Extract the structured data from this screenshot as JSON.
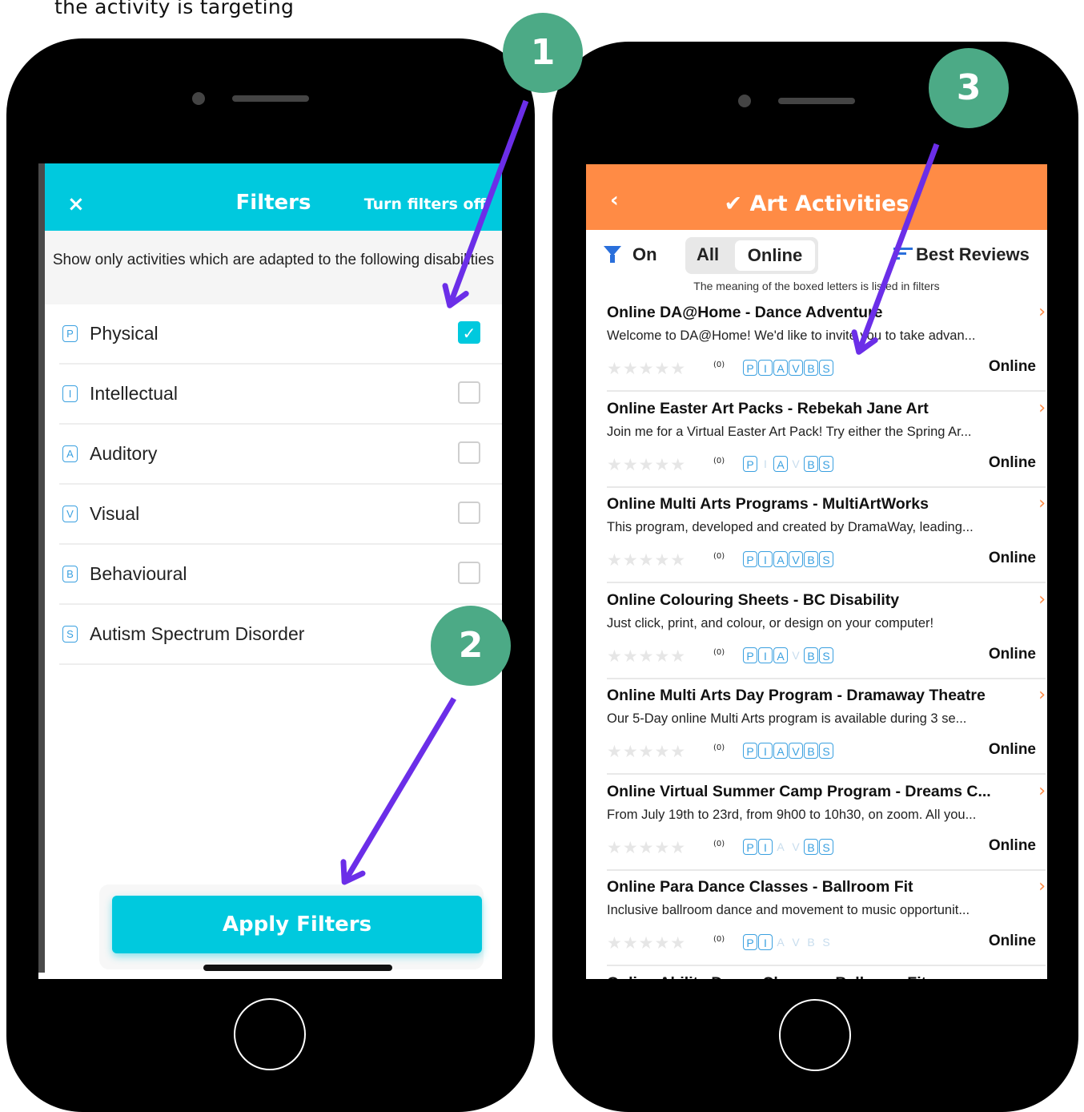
{
  "caption": "the activity is targeting",
  "badges": [
    "1",
    "2",
    "3"
  ],
  "filters": {
    "close_icon": "×",
    "title": "Filters",
    "turn_off": "Turn filters off",
    "intro": "Show only activities which are adapted to the following disabilities",
    "options": [
      {
        "letter": "P",
        "label": "Physical",
        "checked": true
      },
      {
        "letter": "I",
        "label": "Intellectual",
        "checked": false
      },
      {
        "letter": "A",
        "label": "Auditory",
        "checked": false
      },
      {
        "letter": "V",
        "label": "Visual",
        "checked": false
      },
      {
        "letter": "B",
        "label": "Behavioural",
        "checked": false
      },
      {
        "letter": "S",
        "label": "Autism Spectrum Disorder",
        "checked": false
      }
    ],
    "apply_label": "Apply Filters"
  },
  "activities": {
    "back_icon": "‹",
    "title": "Art Activities",
    "filter_state": "On",
    "seg_all": "All",
    "seg_online": "Online",
    "sort_label": "Best Reviews",
    "note": "The meaning of the boxed letters is listed in filters",
    "items": [
      {
        "name": "Online DA@Home - Dance Adventure",
        "desc": "Welcome to DA@Home! We'd like to invite you to take advan...",
        "count": "(0)",
        "letters": "PIAVBS",
        "active": "PIAVBS",
        "mode": "Online"
      },
      {
        "name": "Online Easter Art Packs - Rebekah Jane Art",
        "desc": "Join me for a Virtual Easter Art Pack! Try either the Spring Ar...",
        "count": "(0)",
        "letters": "PIAVBS",
        "active": "PABS",
        "mode": "Online"
      },
      {
        "name": "Online Multi Arts Programs - MultiArtWorks",
        "desc": "This program, developed and created by DramaWay, leading...",
        "count": "(0)",
        "letters": "PIAVBS",
        "active": "PIAVBS",
        "mode": "Online"
      },
      {
        "name": "Online Colouring Sheets - BC Disability",
        "desc": "Just click, print, and colour, or design on your computer!",
        "count": "(0)",
        "letters": "PIAVBS",
        "active": "PIABS",
        "mode": "Online"
      },
      {
        "name": "Online Multi Arts Day Program - Dramaway Theatre",
        "desc": "Our 5-Day online Multi Arts program is available during 3 se...",
        "count": "(0)",
        "letters": "PIAVBS",
        "active": "PIAVBS",
        "mode": "Online"
      },
      {
        "name": "Online Virtual Summer Camp Program - Dreams C...",
        "desc": "From July 19th to 23rd, from 9h00 to 10h30, on zoom. All you...",
        "count": "(0)",
        "letters": "PIAVBS",
        "active": "PIBS",
        "mode": "Online"
      },
      {
        "name": "Online Para Dance Classes - Ballroom Fit",
        "desc": "Inclusive ballroom dance and movement to music opportunit...",
        "count": "(0)",
        "letters": "PIAVBS",
        "active": "PI",
        "mode": "Online"
      },
      {
        "name": "Online Ability Dance Classes - Ballroom Fit",
        "desc": "",
        "count": "",
        "letters": "",
        "active": "",
        "mode": ""
      }
    ]
  },
  "colors": {
    "filters_header": "#00c9de",
    "activities_header": "#ff8b45",
    "badge": "#4caa86",
    "arrow": "#6b2ee8"
  }
}
